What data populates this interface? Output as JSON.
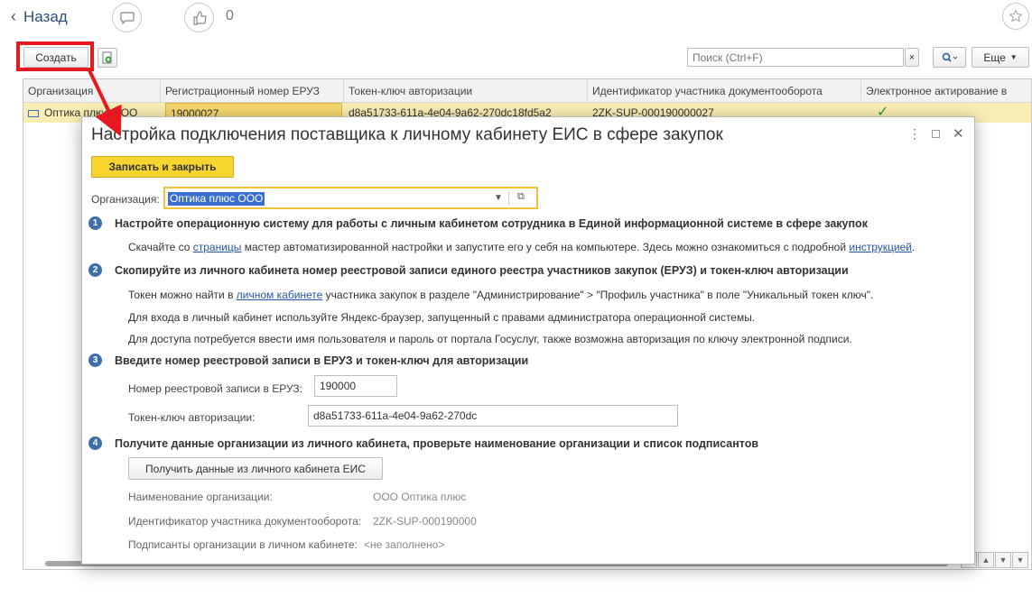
{
  "topbar": {
    "back_label": "Назад",
    "like_count": "0"
  },
  "toolbar": {
    "create_label": "Создать",
    "search_placeholder": "Поиск (Ctrl+F)",
    "clear_symbol": "×",
    "more_label": "Еще"
  },
  "table": {
    "columns": [
      "Организация",
      "Регистрационный номер ЕРУЗ",
      "Токен-ключ авторизации",
      "Идентификатор участника документооборота",
      "Электронное актирование в"
    ],
    "row": {
      "organization": "Оптика плюс ООО",
      "reg_number": "19000027",
      "token": "d8a51733-611a-4e04-9a62-270dc18fd5a2",
      "participant_id": "2ZK-SUP-000190000027"
    }
  },
  "modal": {
    "title": "Настройка подключения поставщика к личному кабинету ЕИС в сфере закупок",
    "save_close_label": "Записать и закрыть",
    "org_label": "Организация:",
    "org_value": "Оптика плюс ООО",
    "steps": [
      {
        "num": "1",
        "title": "Настройте операционную систему для работы с личным кабинетом сотрудника в Единой информационной системе в сфере закупок"
      },
      {
        "num": "2",
        "title": "Скопируйте из личного кабинета номер реестровой записи единого реестра участников закупок (ЕРУЗ) и токен-ключ авторизации"
      },
      {
        "num": "3",
        "title": "Введите номер реестровой записи в ЕРУЗ и токен-ключ для авторизации"
      },
      {
        "num": "4",
        "title": "Получите данные организации из личного кабинета, проверьте наименование организации и список подписантов"
      }
    ],
    "step1": {
      "p1_a": "Скачайте со ",
      "p1_link": "страницы",
      "p1_b": " мастер автоматизированной настройки и запустите его у себя на компьютере. Здесь можно ознакомиться с подробной ",
      "p1_link2": "инструкцией",
      "p1_c": "."
    },
    "step2": {
      "p1_a": "Токен можно найти в ",
      "p1_link": "личном кабинете",
      "p1_b": " участника закупок в разделе \"Администрирование\" > \"Профиль участника\" в поле \"Уникальный токен ключ\".",
      "p2": "Для входа в личный кабинет используйте Яндекс-браузер, запущенный с правами администратора операционной системы.",
      "p3": "Для доступа потребуется ввести имя пользователя и пароль от портала Госуслуг, также возможна авторизация по ключу электронной подписи."
    },
    "step3": {
      "reg_label": "Номер реестровой записи в ЕРУЗ:",
      "reg_value": "190000",
      "token_label": "Токен-ключ авторизации:",
      "token_value": "d8a51733-611a-4e04-9a62-270dc"
    },
    "step4": {
      "button_label": "Получить данные из личного кабинета ЕИС",
      "name_label": "Наименование организации:",
      "name_value": "ООО Оптика плюс",
      "id_label": "Идентификатор участника документооборота:",
      "id_value": "2ZK-SUP-000190000",
      "signers_label": "Подписанты организации в личном кабинете:",
      "signers_value": "<не заполнено>"
    }
  },
  "colors": {
    "highlight_red": "#e5191f",
    "accent_yellow": "#f7d52f",
    "row_selected": "#fbeeb4",
    "step_number_blue": "#3f6fa8",
    "link_blue": "#2456a4"
  }
}
